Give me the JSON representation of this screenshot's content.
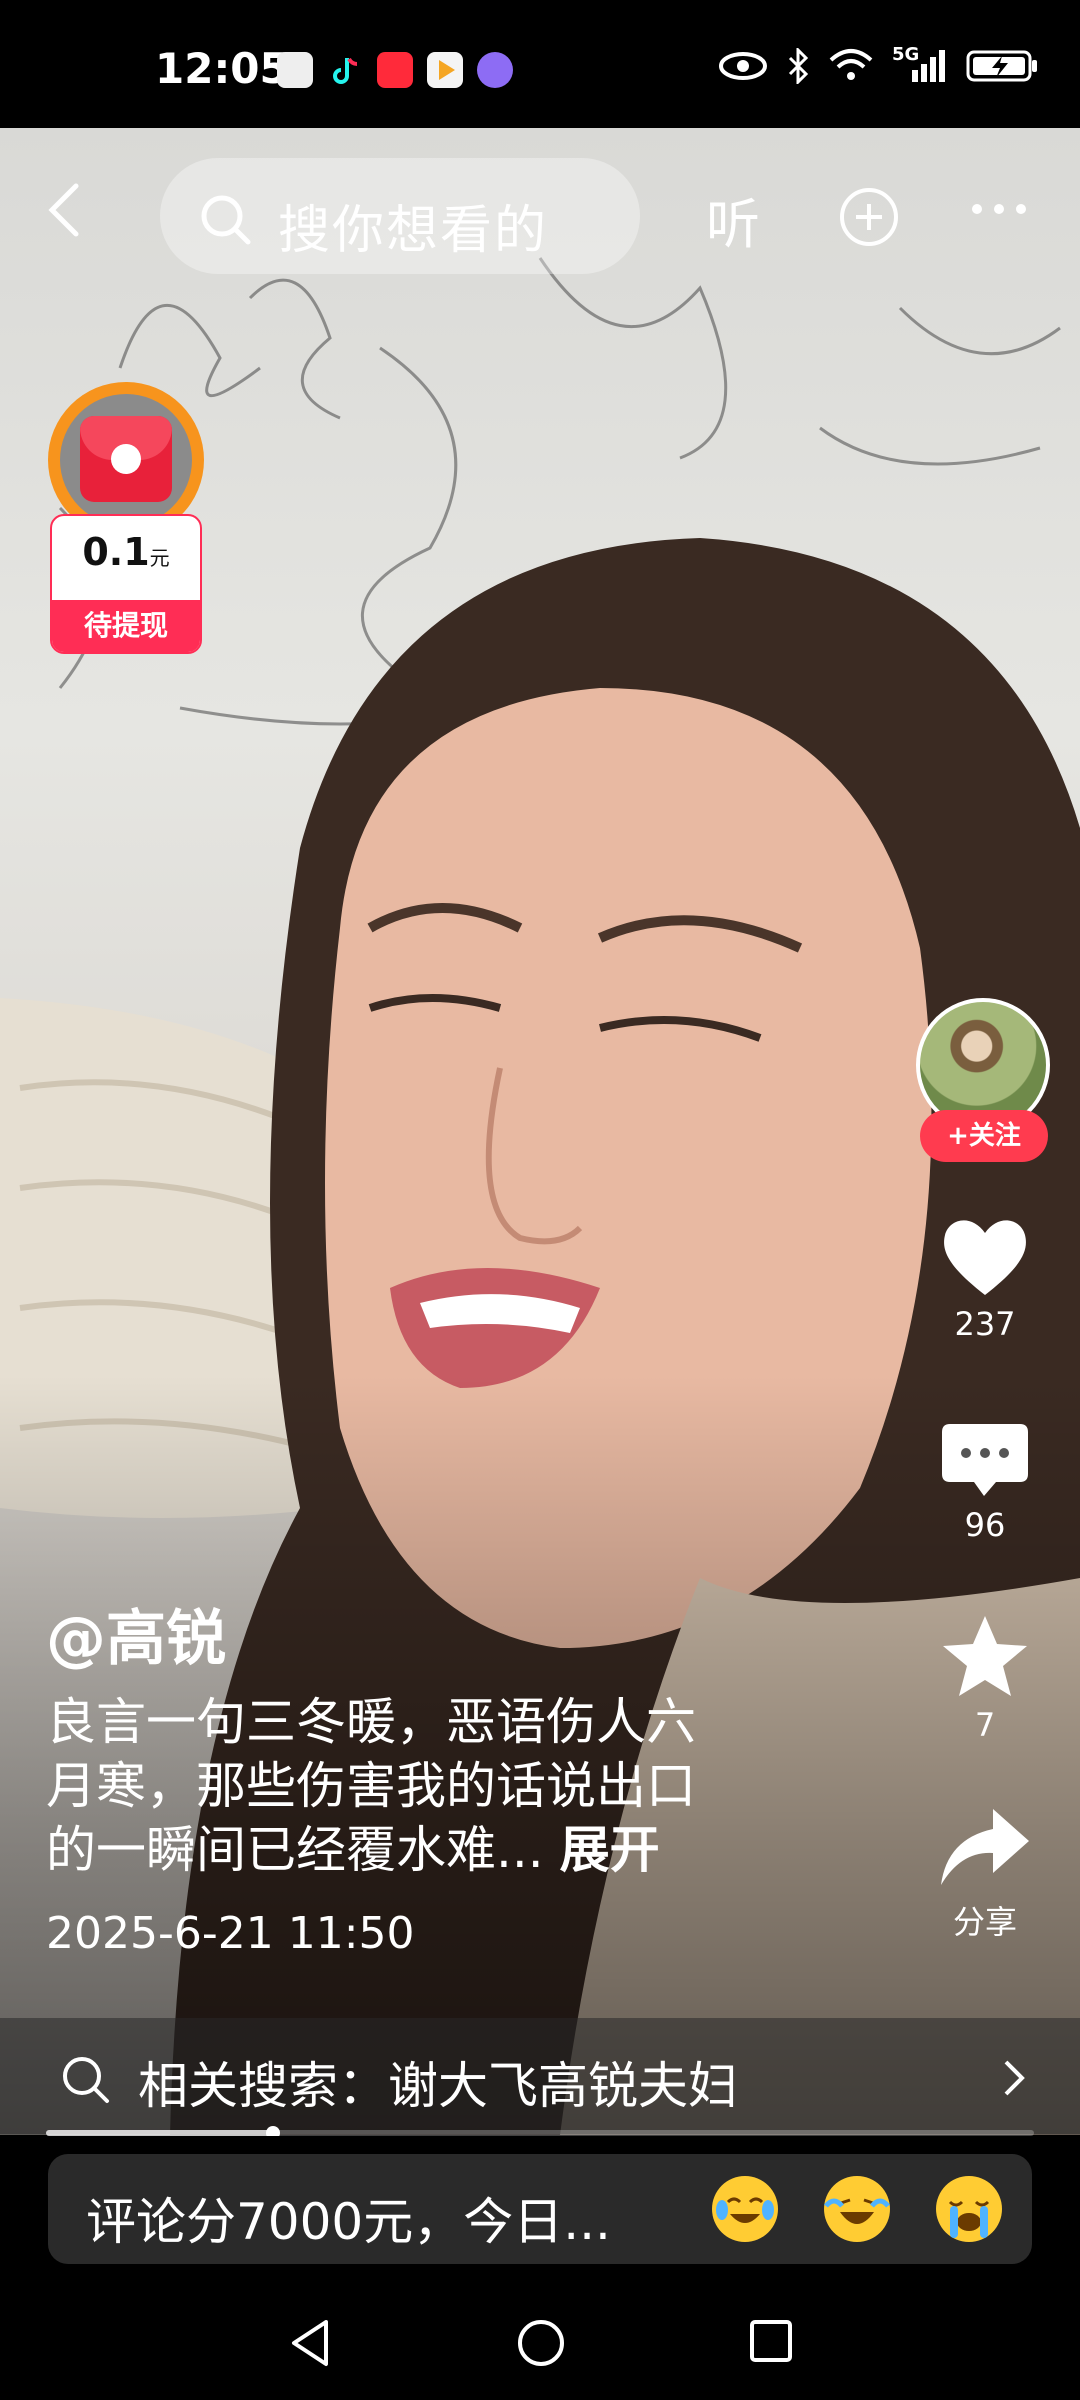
{
  "status_bar": {
    "time": "12:05",
    "network": "5G",
    "notification_apps": [
      "huawei-app-icon",
      "tiktok-icon",
      "red-app-icon",
      "video-play-app-icon",
      "purple-ball-app-icon"
    ],
    "indicators": [
      "eye-icon",
      "bluetooth-icon",
      "wifi-icon",
      "signal-icon",
      "battery-charging-icon"
    ]
  },
  "top_bar": {
    "search_placeholder": "搜你想看的",
    "listen_label": "听"
  },
  "red_packet": {
    "amount": "0.1",
    "unit": "元",
    "status": "待提现"
  },
  "actions": {
    "follow_label": "+关注",
    "likes": "237",
    "comments": "96",
    "favorites": "7",
    "share_label": "分享"
  },
  "post": {
    "author": "@高锐",
    "description_lines": [
      "良言一句三冬暖，恶语伤人六",
      "月寒，那些伤害我的话说出口",
      "的一瞬间已经覆水难..."
    ],
    "expand_label": "展开",
    "datetime": "2025-6-21 11:50"
  },
  "related": {
    "text": "相关搜索：谢大飞高锐夫妇"
  },
  "playback": {
    "progress_fraction": 0.23
  },
  "comment_bar": {
    "placeholder": "评论分7000元，今日...",
    "emojis": [
      "tears-of-joy-emoji",
      "laughing-crying-emoji",
      "loudly-crying-emoji"
    ]
  },
  "colors": {
    "accent_red": "#ff3b4f",
    "red_packet_ring": "#f7941d"
  }
}
